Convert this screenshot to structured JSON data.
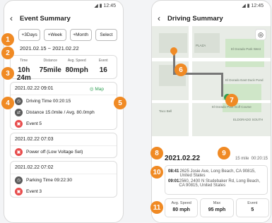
{
  "status": {
    "time": "12:45"
  },
  "left": {
    "title": "Event Summary",
    "buttons": [
      "+3Days",
      "+Week",
      "+Month",
      "Select"
    ],
    "range": "2021.02.15 ~ 2021.02.22",
    "stats": [
      {
        "label": "Time",
        "value": "10h 24m"
      },
      {
        "label": "Distance",
        "value": "75mile"
      },
      {
        "label": "Avg. Speed",
        "value": "80mph"
      },
      {
        "label": "Event",
        "value": "16"
      }
    ],
    "cards": [
      {
        "head": "2021.02.22 09:01",
        "map": "Map",
        "rows": [
          {
            "icon": "timer-icon",
            "text": "Driving Time 00:20:15",
            "color": "#5b5b5b"
          },
          {
            "icon": "distance-icon",
            "text": "Distance 15.0mile / Avg. 80.0mph",
            "color": "#5b5b5b"
          },
          {
            "icon": "car-event-icon",
            "text": "Event 5",
            "color": "#e84c4c"
          }
        ]
      },
      {
        "head": "2021.02.22 07:03",
        "rows": [
          {
            "icon": "car-event-icon",
            "text": "Power off (Low Voltage Set)",
            "color": "#e84c4c"
          }
        ]
      },
      {
        "head": "2021.02.22 07:02",
        "rows": [
          {
            "icon": "timer-icon",
            "text": "Parking Time 09:22:30",
            "color": "#5b5b5b"
          },
          {
            "icon": "car-event-icon",
            "text": "Event 3",
            "color": "#e84c4c"
          }
        ]
      }
    ]
  },
  "right": {
    "title": "Driving Summary",
    "date": "2021.02.22",
    "distance": "15 mile",
    "duration": "00:20:15",
    "trip": [
      {
        "time": "08:41",
        "address": "2625 Josie Ave, Long Beach, CA 90815, United States"
      },
      {
        "time": "09:01",
        "address": "2560, 2400 N Studebaker Rd, Long Beach, CA 90815, United States"
      }
    ],
    "bottom_stats": [
      {
        "label": "Avg. Speed",
        "value": "80 mph"
      },
      {
        "label": "Max",
        "value": "95 mph"
      },
      {
        "label": "Event",
        "value": "5"
      }
    ],
    "map_labels": [
      "PLAZA",
      "El Dorado Park West",
      "El Dorado East Duck Pond",
      "ELDORADO SOUTH",
      "Taco Bell",
      "El Dorado Park Golf Course"
    ]
  },
  "badges": [
    "1",
    "2",
    "3",
    "4",
    "5",
    "6",
    "7",
    "8",
    "9",
    "10",
    "11"
  ]
}
